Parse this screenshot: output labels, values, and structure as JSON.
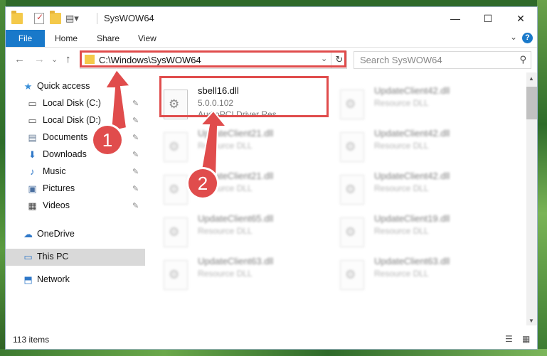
{
  "window": {
    "title": "SysWOW64",
    "controls": {
      "minimize": "—",
      "maximize": "☐",
      "close": "✕"
    }
  },
  "ribbon": {
    "tabs": [
      "File",
      "Home",
      "Share",
      "View"
    ],
    "help": "?",
    "expand": "⌄"
  },
  "nav": {
    "back": "←",
    "forward": "→",
    "history": "⌄",
    "up": "↑",
    "address": "C:\\Windows\\SysWOW64",
    "address_dropdown": "⌄",
    "refresh": "↻",
    "search_placeholder": "Search SysWOW64",
    "search_icon": "⚲"
  },
  "sidebar": {
    "items": [
      {
        "label": "Quick access",
        "icon": "star-icon",
        "glyph": "★",
        "color": "#3a8fd8",
        "pinned": false
      },
      {
        "label": "Local Disk (C:)",
        "icon": "drive-icon",
        "glyph": "▭",
        "color": "#555",
        "pinned": true
      },
      {
        "label": "Local Disk (D:)",
        "icon": "drive-icon",
        "glyph": "▭",
        "color": "#555",
        "pinned": true
      },
      {
        "label": "Documents",
        "icon": "documents-icon",
        "glyph": "▤",
        "color": "#6b7f99",
        "pinned": true
      },
      {
        "label": "Downloads",
        "icon": "downloads-icon",
        "glyph": "⬇",
        "color": "#2f78c8",
        "pinned": true
      },
      {
        "label": "Music",
        "icon": "music-icon",
        "glyph": "♪",
        "color": "#2f78c8",
        "pinned": true
      },
      {
        "label": "Pictures",
        "icon": "pictures-icon",
        "glyph": "▣",
        "color": "#4a6fa0",
        "pinned": true
      },
      {
        "label": "Videos",
        "icon": "videos-icon",
        "glyph": "▦",
        "color": "#444",
        "pinned": true
      },
      {
        "label": "OneDrive",
        "icon": "cloud-icon",
        "glyph": "☁",
        "color": "#2f78c8",
        "pinned": false
      },
      {
        "label": "This PC",
        "icon": "computer-icon",
        "glyph": "▭",
        "color": "#2f78c8",
        "pinned": false
      },
      {
        "label": "Network",
        "icon": "network-icon",
        "glyph": "⬒",
        "color": "#2f78c8",
        "pinned": false
      }
    ],
    "pin_glyph": "📌",
    "selected": "This PC"
  },
  "files": {
    "highlighted": {
      "name": "sbell16.dll",
      "version": "5.0.0.102",
      "description": "AudioPCI Driver Res..."
    },
    "column1": [
      {
        "name": "UpdateClient21.dll",
        "type": "Resource DLL"
      },
      {
        "name": "UpdateClient21.dll",
        "type": "Resource DLL"
      },
      {
        "name": "UpdateClient65.dll",
        "type": "Resource DLL"
      },
      {
        "name": "UpdateClient63.dll",
        "type": "Resource DLL"
      }
    ],
    "column2": [
      {
        "name": "UpdateClient42.dll",
        "type": "Resource DLL"
      },
      {
        "name": "UpdateClient42.dll",
        "type": "Resource DLL"
      },
      {
        "name": "UpdateClient42.dll",
        "type": "Resource DLL"
      },
      {
        "name": "UpdateClient19.dll",
        "type": "Resource DLL"
      },
      {
        "name": "UpdateClient63.dll",
        "type": "Resource DLL"
      }
    ]
  },
  "status": {
    "item_count": "113 items",
    "view_details": "☰",
    "view_tiles": "▦"
  },
  "scrollbar": {
    "up": "▲",
    "down": "▼"
  },
  "annotations": {
    "step1": "1",
    "step2": "2",
    "color": "#e04c4c"
  }
}
